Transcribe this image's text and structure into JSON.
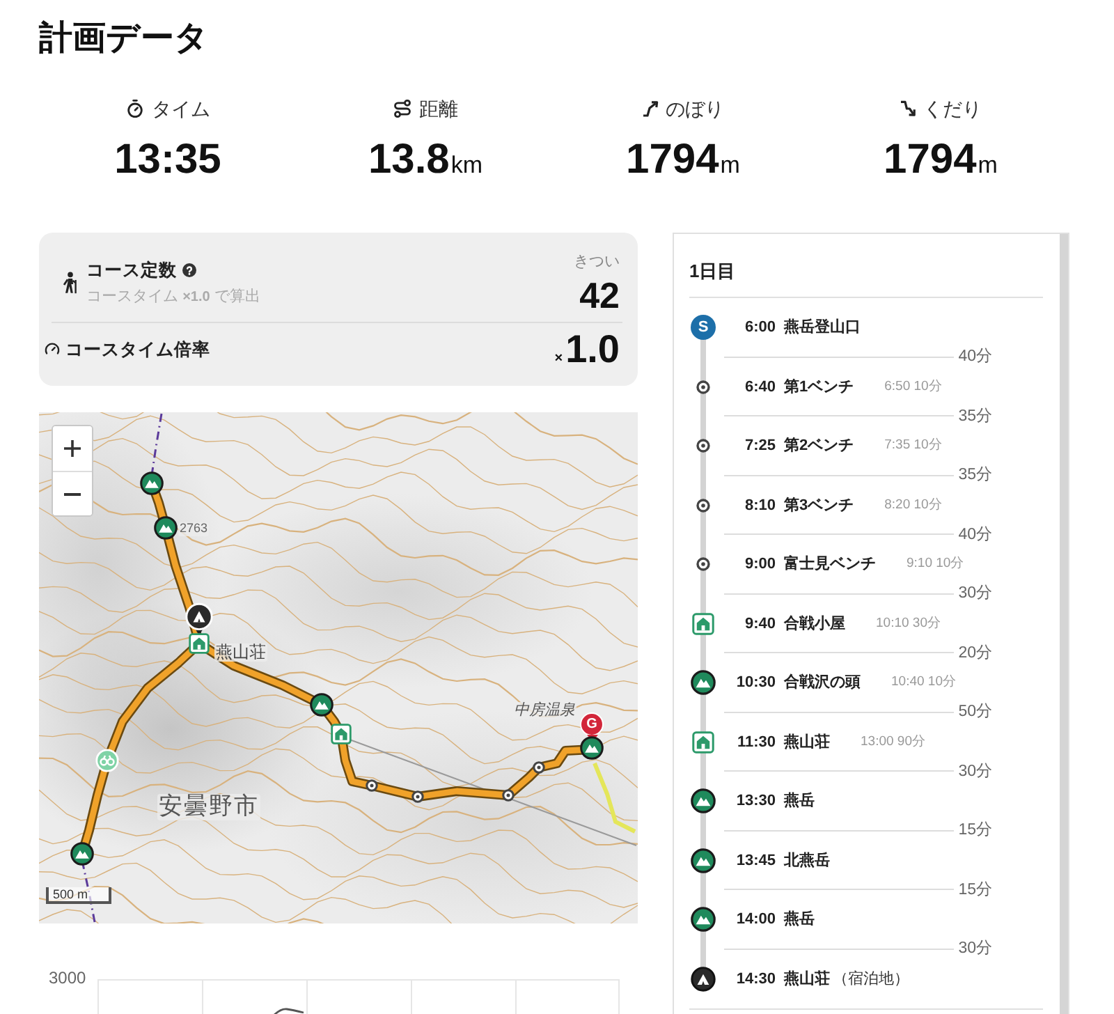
{
  "title": "計画データ",
  "stats": [
    {
      "kind": "time",
      "label": "タイム",
      "value": "13:35"
    },
    {
      "kind": "distance",
      "label": "距離",
      "value": "13.8",
      "unit": "km"
    },
    {
      "kind": "ascent",
      "label": "のぼり",
      "value": "1794",
      "unit": "m"
    },
    {
      "kind": "descent",
      "label": "くだり",
      "value": "1794",
      "unit": "m"
    }
  ],
  "course_card": {
    "constant": {
      "label": "コース定数",
      "note": "コースタイム **×1.0** で算出",
      "rating": "きつい",
      "value": "42"
    },
    "multiplier": {
      "label": "コースタイム倍率",
      "prefix": "×",
      "value": "1.0"
    }
  },
  "map": {
    "labels": [
      "2763",
      "燕山荘",
      "中房温泉",
      "安曇野市"
    ],
    "markers": [
      {
        "kind": "peak"
      },
      {
        "kind": "peak"
      },
      {
        "kind": "lodging"
      },
      {
        "kind": "hut"
      },
      {
        "kind": "peak"
      },
      {
        "kind": "goal",
        "badge": "G"
      },
      {
        "kind": "hut"
      },
      {
        "kind": "peak"
      },
      {
        "kind": "viewpoint"
      },
      {
        "kind": "bench"
      },
      {
        "kind": "bench"
      },
      {
        "kind": "bench"
      },
      {
        "kind": "bench"
      },
      {
        "kind": "peak"
      }
    ],
    "scale": "500 m"
  },
  "elevation_chart": {
    "ytick": "3000"
  },
  "schedule": {
    "day": "1日目",
    "stops": [
      {
        "kind": "start",
        "badge": "S",
        "time": "6:00",
        "name": "燕岳登山口",
        "leg": "40分"
      },
      {
        "kind": "bench",
        "time": "6:40",
        "name": "第1ベンチ",
        "departure": "6:50 10分",
        "leg": "35分"
      },
      {
        "kind": "bench",
        "time": "7:25",
        "name": "第2ベンチ",
        "departure": "7:35 10分",
        "leg": "35分"
      },
      {
        "kind": "bench",
        "time": "8:10",
        "name": "第3ベンチ",
        "departure": "8:20 10分",
        "leg": "40分"
      },
      {
        "kind": "bench",
        "time": "9:00",
        "name": "富士見ベンチ",
        "departure": "9:10 10分",
        "leg": "30分"
      },
      {
        "kind": "hut",
        "time": "9:40",
        "name": "合戦小屋",
        "departure": "10:10 30分",
        "leg": "20分"
      },
      {
        "kind": "peak",
        "time": "10:30",
        "name": "合戦沢の頭",
        "departure": "10:40 10分",
        "leg": "50分"
      },
      {
        "kind": "hut",
        "time": "11:30",
        "name": "燕山荘",
        "departure": "13:00 90分",
        "leg": "30分"
      },
      {
        "kind": "peak",
        "time": "13:30",
        "name": "燕岳",
        "leg": "15分"
      },
      {
        "kind": "peak",
        "time": "13:45",
        "name": "北燕岳",
        "leg": "15分"
      },
      {
        "kind": "peak",
        "time": "14:00",
        "name": "燕岳",
        "leg": "30分"
      },
      {
        "kind": "lodging",
        "time": "14:30",
        "name": "燕山荘",
        "note": "（宿泊地）"
      }
    ]
  }
}
